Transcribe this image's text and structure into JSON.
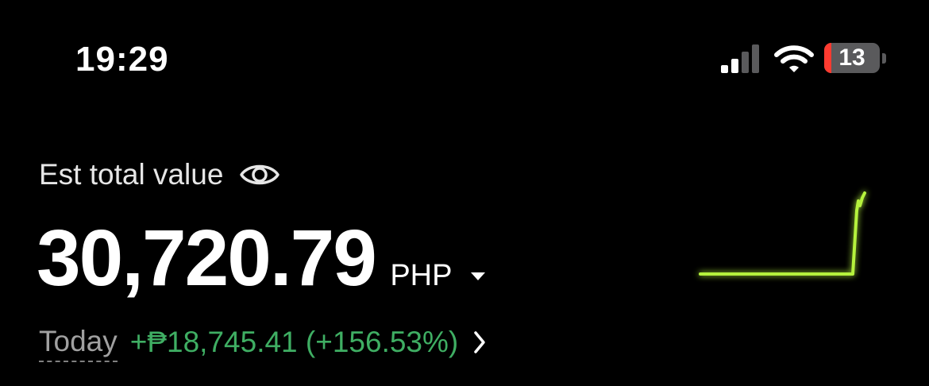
{
  "status_bar": {
    "time": "19:29",
    "battery_level": "13",
    "battery_fraction": 0.13,
    "signal_bars_active": 2,
    "signal_bars_total": 4,
    "icons": [
      "signal-icon",
      "wifi-icon",
      "battery-icon"
    ],
    "battery_color": "#ff3b30"
  },
  "portfolio": {
    "label": "Est total value",
    "value": "30,720.79",
    "currency": "PHP",
    "today_label": "Today",
    "today_change": "+₱18,745.41 (+156.53%)",
    "change_color": "#3fae63",
    "sparkline_color": "#b5f23c",
    "icons": [
      "eye-icon",
      "caret-down-icon",
      "chevron-right-icon"
    ]
  }
}
